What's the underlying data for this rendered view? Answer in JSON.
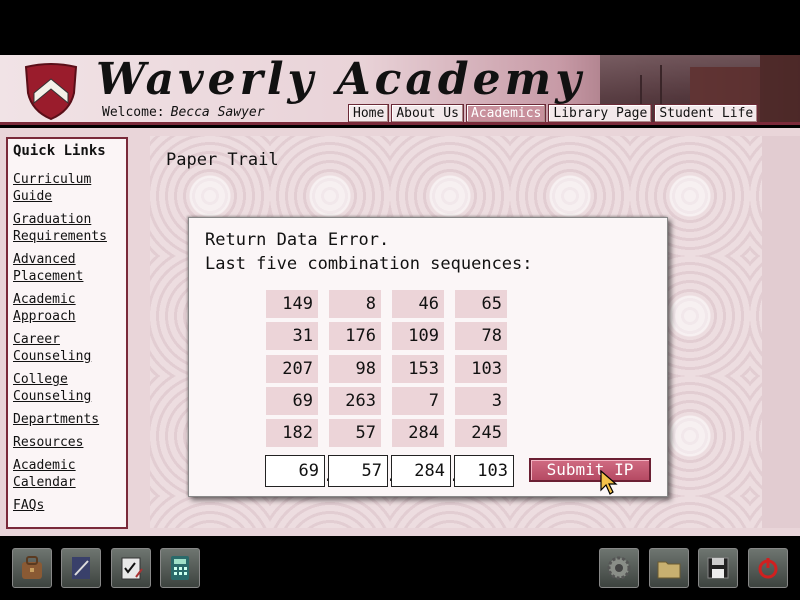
{
  "header": {
    "title": "Waverly Academy",
    "welcome_label": "Welcome:",
    "user_name": "Becca Sawyer",
    "nav": [
      "Home",
      "About Us",
      "Academics",
      "Library Page",
      "Student Life"
    ],
    "active_nav": "Academics"
  },
  "sidebar": {
    "title": "Quick Links",
    "items": [
      [
        "Curriculum",
        "Guide"
      ],
      [
        "Graduation",
        "Requirements"
      ],
      [
        "Advanced",
        "Placement"
      ],
      [
        "Academic",
        "Approach"
      ],
      [
        "Career",
        "Counseling"
      ],
      [
        "College",
        "Counseling"
      ],
      [
        "Departments"
      ],
      [
        "Resources"
      ],
      [
        "Academic",
        "Calendar"
      ],
      [
        "FAQs"
      ]
    ]
  },
  "main": {
    "heading": "Paper Trail",
    "dialog": {
      "line1": "Return Data Error.",
      "line2": "Last five combination sequences:",
      "rows": [
        [
          "149",
          "8",
          "46",
          "65"
        ],
        [
          "31",
          "176",
          "109",
          "78"
        ],
        [
          "207",
          "98",
          "153",
          "103"
        ],
        [
          "69",
          "263",
          "7",
          "3"
        ],
        [
          "182",
          "57",
          "284",
          "245"
        ]
      ],
      "inputs": [
        "69",
        "57",
        "284",
        "103"
      ],
      "separator": ".",
      "submit_label": "Submit IP"
    }
  },
  "toolbar": {
    "left": [
      "satchel-icon",
      "notebook-icon",
      "checklist-icon",
      "calculator-icon"
    ],
    "right": [
      "settings-gear-icon",
      "folder-icon",
      "save-disk-icon",
      "power-icon"
    ]
  },
  "colors": {
    "accent": "#7a2a3a",
    "cell_bg": "#ecd4d8",
    "submit_bg": "#c05a72",
    "active_tab": "#c8909c"
  }
}
